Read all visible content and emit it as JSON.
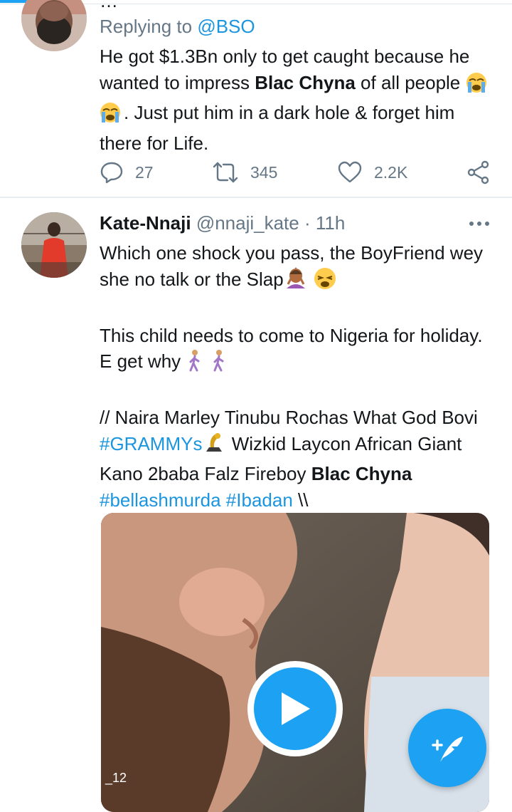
{
  "tweet1": {
    "header_partial": "…",
    "replying_label": "Replying to",
    "replying_handle": "@BSO",
    "text_before": "He got $1.3Bn only to get caught because he wanted to impress ",
    "text_bold": "Blac Chyna",
    "text_mid": " of all people",
    "text_after": ". Just put him in a dark hole & forget him there for Life.",
    "reply_count": "27",
    "retweet_count": "345",
    "like_count": "2.2K"
  },
  "tweet2": {
    "author_name": "Kate-Nnaji",
    "author_handle": "@nnaji_kate",
    "time": "· 11h",
    "line1": "Which one shock you pass, the BoyFriend wey she no talk or the Slap",
    "line2": "This child needs to come to Nigeria for holiday. E get why",
    "line3_a": "// Naira Marley Tinubu Rochas What God Bovi  ",
    "hashtag_grammys": "#GRAMMYs",
    "line3_b": " Wizkid Laycon African Giant Kano 2baba Falz Fireboy ",
    "line3_bold": "Blac Chyna",
    "hashtag_bellashmurda": "#bellashmurda",
    "hashtag_ibadan": "#Ibadan",
    "line3_end": " \\\\",
    "media_counter": "_12"
  },
  "colors": {
    "accent": "#1da1f2",
    "link": "#1b95e0",
    "muted": "#657786",
    "text": "#14171a"
  },
  "icons": [
    "reply-icon",
    "retweet-icon",
    "like-icon",
    "share-icon",
    "more-icon",
    "play-icon",
    "compose-icon"
  ]
}
